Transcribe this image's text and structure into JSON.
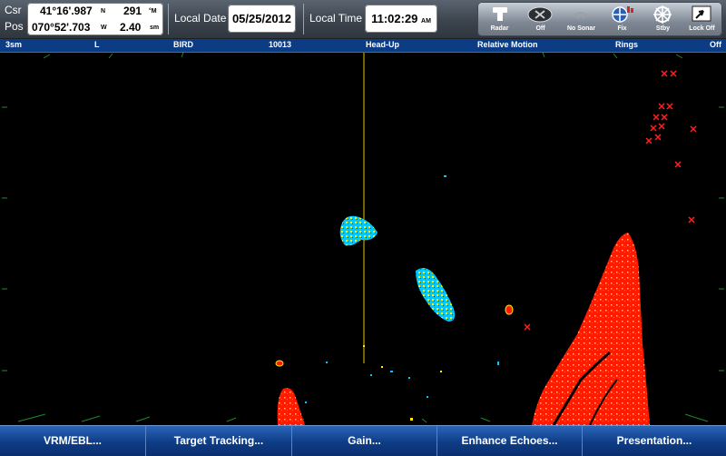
{
  "position": {
    "cursor_label": "Csr",
    "pos_label": "Pos",
    "latitude": "41°16'.987",
    "lat_hemisphere": "N",
    "longitude": "070°52'.703",
    "lon_hemisphere": "W",
    "bearing": "291",
    "bearing_unit": "°M",
    "range": "2.40",
    "range_unit": "sm"
  },
  "date": {
    "label": "Local Date",
    "value": "05/25/2012"
  },
  "time": {
    "label": "Local Time",
    "value": "11:02:29",
    "suffix": "AM"
  },
  "toolbar": {
    "buttons": [
      {
        "label": "Radar",
        "icon": "radar-antenna-icon"
      },
      {
        "label": "Off",
        "icon": "off-icon"
      },
      {
        "label": "No Sonar",
        "icon": "sonar-icon"
      },
      {
        "label": "Fix",
        "icon": "gps-fix-icon"
      },
      {
        "label": "Stby",
        "icon": "helm-icon"
      },
      {
        "label": "Lock Off",
        "icon": "lock-icon"
      }
    ]
  },
  "status": {
    "range": "3sm",
    "gain_mode": "L",
    "preset": "BIRD",
    "value": "10013",
    "orientation": "Head-Up",
    "motion": "Relative Motion",
    "rings_label": "Rings",
    "rings_value": "Off"
  },
  "softkeys": [
    {
      "label": "VRM/EBL..."
    },
    {
      "label": "Target Tracking..."
    },
    {
      "label": "Gain..."
    },
    {
      "label": "Enhance Echoes..."
    },
    {
      "label": "Presentation..."
    }
  ],
  "colors": {
    "strong_echo": "#ff1a00",
    "medium_echo": "#ffee00",
    "weak_echo": "#00c8ff",
    "heading_line": "#e8c400",
    "target_marker": "#ff2020",
    "status_bar": "#0c3c84"
  }
}
